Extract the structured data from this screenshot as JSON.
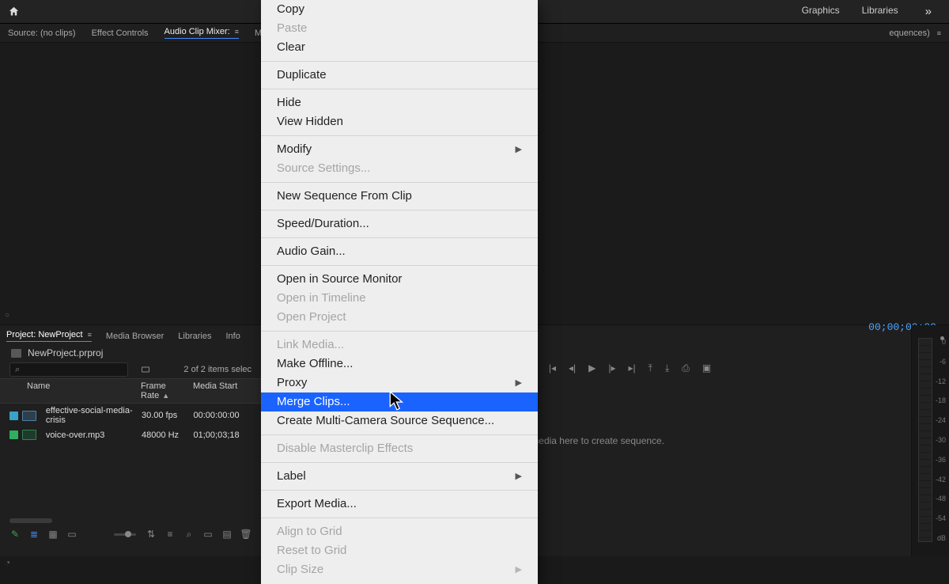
{
  "topbar": {
    "tabs": [
      "Graphics",
      "Libraries"
    ]
  },
  "subbar": {
    "source_label": "Source: (no clips)",
    "effect_controls": "Effect Controls",
    "audio_mixer": "Audio Clip Mixer:",
    "metadata": "Metadata",
    "right_label": "equences)"
  },
  "program": {
    "timecode": "00;00;00;00",
    "drop_hint": "Drop media here to create sequence."
  },
  "project": {
    "tabs": {
      "project": "Project: NewProject",
      "media": "Media Browser",
      "libraries": "Libraries",
      "info": "Info"
    },
    "file": "NewProject.prproj",
    "search_icon": "⌕",
    "selection": "2 of 2 items selec",
    "headers": {
      "name": "Name",
      "frame_rate": "Frame Rate",
      "media_start": "Media Start"
    },
    "items": [
      {
        "swatch": "#3aa2c9",
        "name": "effective-social-media-crisis",
        "fr": "30.00 fps",
        "ms": "00:00:00:00",
        "icon": "video"
      },
      {
        "swatch": "#2fae5f",
        "name": "voice-over.mp3",
        "fr": "48000 Hz",
        "ms": "01;00;03;18",
        "icon": "audio"
      }
    ]
  },
  "audio_meter": {
    "ticks": [
      "0",
      "-6",
      "-12",
      "-18",
      "-24",
      "-30",
      "-36",
      "-42",
      "-48",
      "-54",
      "dB"
    ]
  },
  "context_menu": {
    "items": [
      {
        "label": "Copy",
        "enabled": true
      },
      {
        "label": "Paste",
        "enabled": false
      },
      {
        "label": "Clear",
        "enabled": true
      },
      {
        "sep": true
      },
      {
        "label": "Duplicate",
        "enabled": true
      },
      {
        "sep": true
      },
      {
        "label": "Hide",
        "enabled": true
      },
      {
        "label": "View Hidden",
        "enabled": true
      },
      {
        "sep": true
      },
      {
        "label": "Modify",
        "enabled": true,
        "sub": true
      },
      {
        "label": "Source Settings...",
        "enabled": false
      },
      {
        "sep": true
      },
      {
        "label": "New Sequence From Clip",
        "enabled": true
      },
      {
        "sep": true
      },
      {
        "label": "Speed/Duration...",
        "enabled": true
      },
      {
        "sep": true
      },
      {
        "label": "Audio Gain...",
        "enabled": true
      },
      {
        "sep": true
      },
      {
        "label": "Open in Source Monitor",
        "enabled": true
      },
      {
        "label": "Open in Timeline",
        "enabled": false
      },
      {
        "label": "Open Project",
        "enabled": false
      },
      {
        "sep": true
      },
      {
        "label": "Link Media...",
        "enabled": false
      },
      {
        "label": "Make Offline...",
        "enabled": true
      },
      {
        "label": "Proxy",
        "enabled": true,
        "sub": true
      },
      {
        "label": "Merge Clips...",
        "enabled": true,
        "selected": true
      },
      {
        "label": "Create Multi-Camera Source Sequence...",
        "enabled": true
      },
      {
        "sep": true
      },
      {
        "label": "Disable Masterclip Effects",
        "enabled": false
      },
      {
        "sep": true
      },
      {
        "label": "Label",
        "enabled": true,
        "sub": true
      },
      {
        "sep": true
      },
      {
        "label": "Export Media...",
        "enabled": true
      },
      {
        "sep": true
      },
      {
        "label": "Align to Grid",
        "enabled": false
      },
      {
        "label": "Reset to Grid",
        "enabled": false
      },
      {
        "label": "Clip Size",
        "enabled": false,
        "sub": true
      }
    ]
  }
}
